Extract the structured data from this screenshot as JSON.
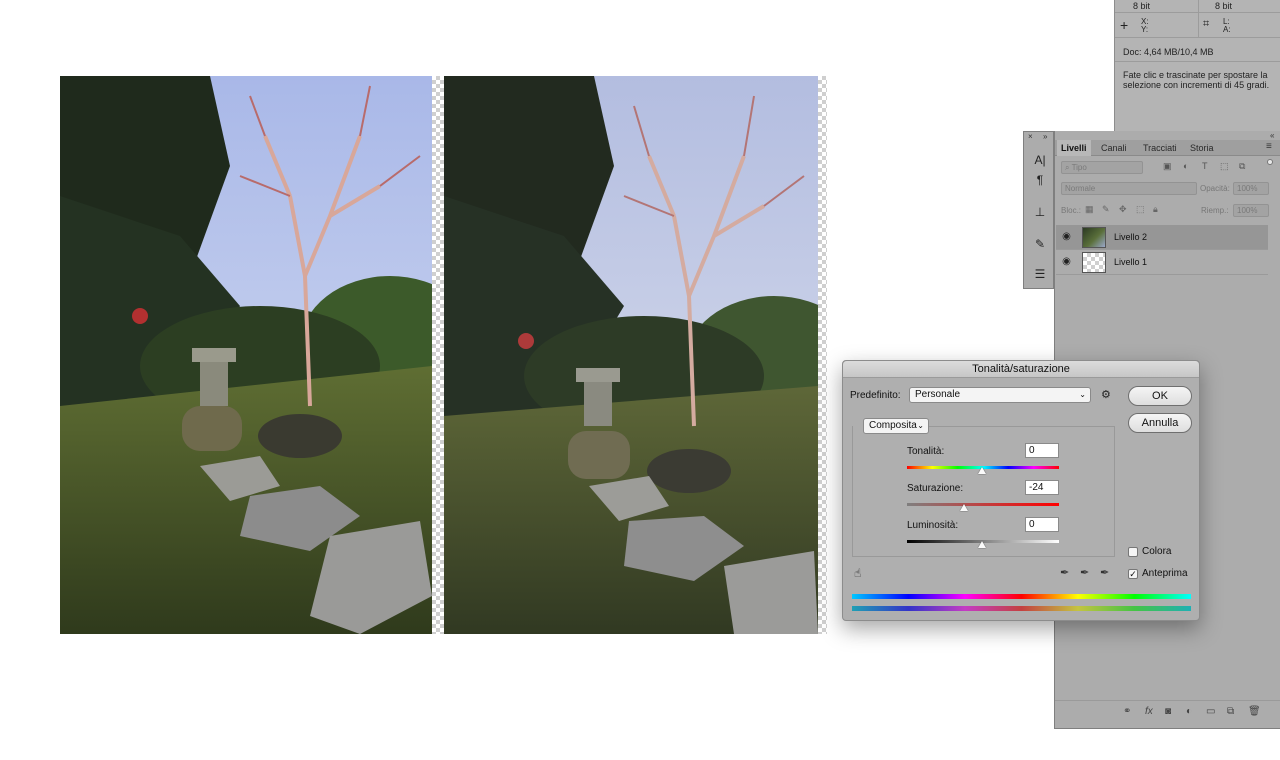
{
  "info_panel": {
    "bit_left": "8 bit",
    "bit_right": "8 bit",
    "x_label": "X:",
    "y_label": "Y:",
    "l_label": "L:",
    "a_label": "A:",
    "doc_size": "Doc: 4,64 MB/10,4 MB",
    "hint": "Fate clic e trascinate per spostare la selezione con incrementi di 45 gradi."
  },
  "layers_panel": {
    "tabs": [
      "Livelli",
      "Canali",
      "Tracciati",
      "Storia"
    ],
    "active_tab": "Livelli",
    "filter_placeholder": "Tipo",
    "blend_mode": "Normale",
    "opacity_label": "Opacità:",
    "opacity_value": "100%",
    "lock_label": "Bloc.:",
    "fill_label": "Riemp.:",
    "fill_value": "100%",
    "layers": [
      {
        "name": "Livello 2",
        "selected": true
      },
      {
        "name": "Livello 1",
        "selected": false
      }
    ]
  },
  "dialog": {
    "title": "Tonalità/saturazione",
    "preset_label": "Predefinito:",
    "preset_value": "Personale",
    "ok_label": "OK",
    "cancel_label": "Annulla",
    "channel_value": "Composita",
    "hue_label": "Tonalità:",
    "hue_value": "0",
    "saturation_label": "Saturazione:",
    "saturation_value": "-24",
    "lightness_label": "Luminosità:",
    "lightness_value": "0",
    "colorize_label": "Colora",
    "colorize_checked": false,
    "preview_label": "Anteprima",
    "preview_checked": true
  },
  "icons": {
    "gear": "gear-icon",
    "eye": "eye-icon",
    "hand": "hand-icon",
    "eyedropper": "eyedropper-icon"
  }
}
